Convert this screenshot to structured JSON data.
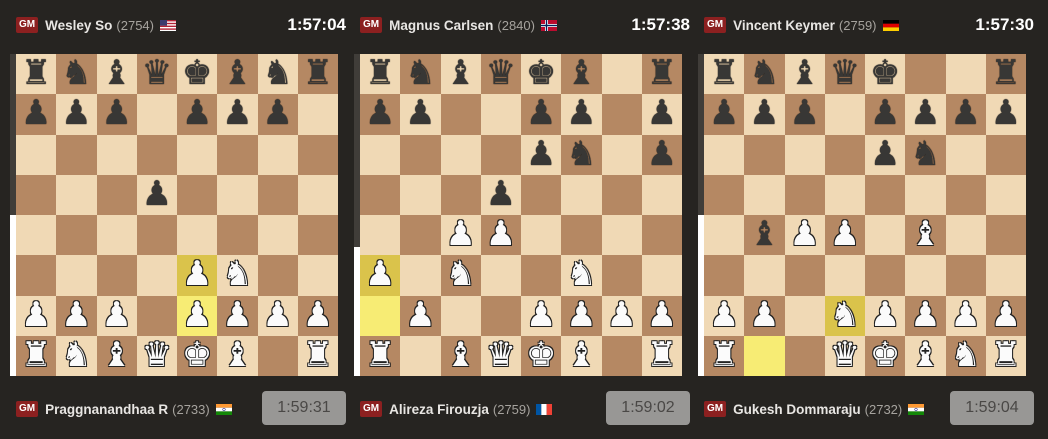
{
  "games": [
    {
      "top": {
        "title": "GM",
        "name": "Wesley So",
        "rating": "(2754)",
        "flag": "us",
        "clock": "1:57:04"
      },
      "bottom": {
        "title": "GM",
        "name": "Praggnanandhaa R",
        "rating": "(2733)",
        "flag": "in",
        "clock": "1:59:31"
      },
      "eval_white_fraction": 0.5,
      "board": [
        "rnbqkbnr",
        "ppp.ppp.",
        "........",
        "...p....",
        "........",
        "....PN..",
        "PPP.PPPP",
        "RNBQKB.R"
      ],
      "highlight": [
        "e3",
        "e2"
      ]
    },
    {
      "top": {
        "title": "GM",
        "name": "Magnus Carlsen",
        "rating": "(2840)",
        "flag": "no",
        "clock": "1:57:38"
      },
      "bottom": {
        "title": "GM",
        "name": "Alireza Firouzja",
        "rating": "(2759)",
        "flag": "fr",
        "clock": "1:59:02"
      },
      "eval_white_fraction": 0.4,
      "board": [
        "rnbqkb.r",
        "pp..pp.p",
        "....pn.p",
        "...p....",
        "..PP....",
        "P.N..N..",
        ".P..PPPP",
        "R.BQKB.R"
      ],
      "highlight": [
        "a3",
        "a2"
      ]
    },
    {
      "top": {
        "title": "GM",
        "name": "Vincent Keymer",
        "rating": "(2759)",
        "flag": "de",
        "clock": "1:57:30"
      },
      "bottom": {
        "title": "GM",
        "name": "Gukesh Dommaraju",
        "rating": "(2732)",
        "flag": "in",
        "clock": "1:59:04"
      },
      "eval_white_fraction": 0.5,
      "board": [
        "rnbqk..r",
        "ppp.pppp",
        "....pn..",
        "........",
        ".bPP.B..",
        "........",
        "PP.NPPPP",
        "R..QKBNR"
      ],
      "highlight": [
        "d2",
        "b1"
      ]
    }
  ]
}
